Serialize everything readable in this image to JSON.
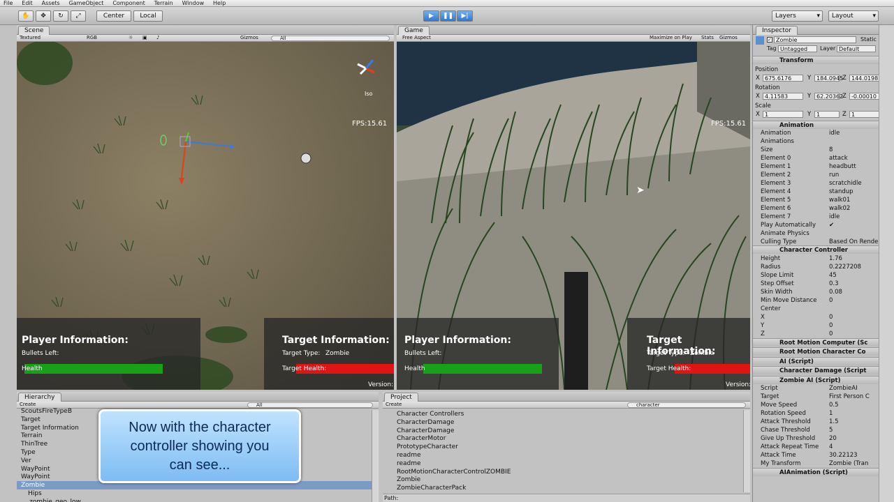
{
  "menu": [
    "File",
    "Edit",
    "Assets",
    "GameObject",
    "Component",
    "Terrain",
    "Window",
    "Help"
  ],
  "toolbar": {
    "pivot": "Center",
    "space": "Local",
    "layers": "Layers",
    "layout": "Layout"
  },
  "scene": {
    "tab": "Scene",
    "draw_mode": "Textured",
    "render_mode": "RGB",
    "gizmos": "Gizmos",
    "search": "All",
    "projection": "Iso",
    "fps": "FPS:15.61",
    "player_title": "Player Information:",
    "bullets": "Bullets Left:",
    "health": "Health",
    "target_title": "Target Information:",
    "target_type_label": "Target Type:",
    "target_type": "Zombie",
    "target_health": "Target Health:",
    "version": "Version:"
  },
  "game": {
    "tab": "Game",
    "aspect": "Free Aspect",
    "maximize": "Maximize on Play",
    "stats": "Stats",
    "gizmos": "Gizmos",
    "fps": "FPS:15.61",
    "player_title": "Player Information:",
    "bullets": "Bullets Left:",
    "health": "Health",
    "target_title": "Target Information:",
    "target_type_label": "Target Type:",
    "target_type": "Zombie",
    "target_health": "Target Health:",
    "version": "Version:"
  },
  "inspector": {
    "tab": "Inspector",
    "object_name": "Zombie",
    "static": "Static",
    "tag_label": "Tag",
    "tag": "Untagged",
    "layer_label": "Layer",
    "layer": "Default",
    "transform": "Transform",
    "position_label": "Position",
    "position": {
      "x": "675.6176",
      "y": "184.0945",
      "z": "144.0198"
    },
    "rotation_label": "Rotation",
    "rotation": {
      "x": "4.11583",
      "y": "62.20362",
      "z": "-0.00010"
    },
    "scale_label": "Scale",
    "scale": {
      "x": "1",
      "y": "1",
      "z": "1"
    },
    "animation_comp": "Animation",
    "animation_rows": [
      {
        "k": "Animation",
        "v": "idle"
      },
      {
        "k": "Animations",
        "v": ""
      },
      {
        "k": "Size",
        "v": "8"
      },
      {
        "k": "Element 0",
        "v": "attack"
      },
      {
        "k": "Element 1",
        "v": "headbutt"
      },
      {
        "k": "Element 2",
        "v": "run"
      },
      {
        "k": "Element 3",
        "v": "scratchidle"
      },
      {
        "k": "Element 4",
        "v": "standup"
      },
      {
        "k": "Element 5",
        "v": "walk01"
      },
      {
        "k": "Element 6",
        "v": "walk02"
      },
      {
        "k": "Element 7",
        "v": "idle"
      },
      {
        "k": "Play Automatically",
        "v": "✔"
      },
      {
        "k": "Animate Physics",
        "v": ""
      },
      {
        "k": "Culling Type",
        "v": "Based On Rende"
      }
    ],
    "cc_comp": "Character Controller",
    "cc_rows": [
      {
        "k": "Height",
        "v": "1.76"
      },
      {
        "k": "Radius",
        "v": "0.2227208"
      },
      {
        "k": "Slope Limit",
        "v": "45"
      },
      {
        "k": "Step Offset",
        "v": "0.3"
      },
      {
        "k": "Skin Width",
        "v": "0.08"
      },
      {
        "k": "Min Move Distance",
        "v": "0"
      },
      {
        "k": "Center",
        "v": ""
      },
      {
        "k": "X",
        "v": "0"
      },
      {
        "k": "Y",
        "v": "0"
      },
      {
        "k": "Z",
        "v": "0"
      }
    ],
    "collapsed": [
      "Root Motion Computer (Sc",
      "Root Motion Character Co",
      "AI (Script)",
      "Character Damage (Script"
    ],
    "zombie_ai": "Zombie AI (Script)",
    "zombie_rows": [
      {
        "k": "Script",
        "v": "ZombieAI"
      },
      {
        "k": "Target",
        "v": "First Person C"
      },
      {
        "k": "Move Speed",
        "v": "0.5"
      },
      {
        "k": "Rotation Speed",
        "v": "1"
      },
      {
        "k": "Attack Threshold",
        "v": "1.5"
      },
      {
        "k": "Chase Threshold",
        "v": "5"
      },
      {
        "k": "Give Up Threshold",
        "v": "20"
      },
      {
        "k": "Attack Repeat Time",
        "v": "4"
      },
      {
        "k": "Attack Time",
        "v": "30.22123"
      },
      {
        "k": "My Transform",
        "v": "Zombie (Tran"
      }
    ],
    "ai_animation": "AIAnimation (Script)"
  },
  "hierarchy": {
    "tab": "Hierarchy",
    "create": "Create",
    "search": "All",
    "items": [
      "ScoutsFireTypeB",
      "Target",
      "Target Information",
      "Terrain",
      "ThinTree",
      "Type",
      "Ver",
      "WayPoint",
      "WayPoint",
      "Zombie",
      "Hips",
      "zombie_geo_low"
    ]
  },
  "project": {
    "tab": "Project",
    "create": "Create",
    "search": "character",
    "items": [
      "Character Controllers",
      "CharacterDamage",
      "CharacterDamage",
      "CharacterMotor",
      "PrototypeCharacter",
      "readme",
      "readme",
      "RootMotionCharacterControlZOMBIE",
      "Zombie",
      "ZombieCharacterPack"
    ],
    "path_label": "Path:"
  },
  "caption": {
    "line1": "Now with the character",
    "line2": "controller showing you",
    "line3": "can see..."
  },
  "colors": {
    "health_green": "#19a019",
    "health_red": "#e11414",
    "selection": "#7b9bc7"
  }
}
